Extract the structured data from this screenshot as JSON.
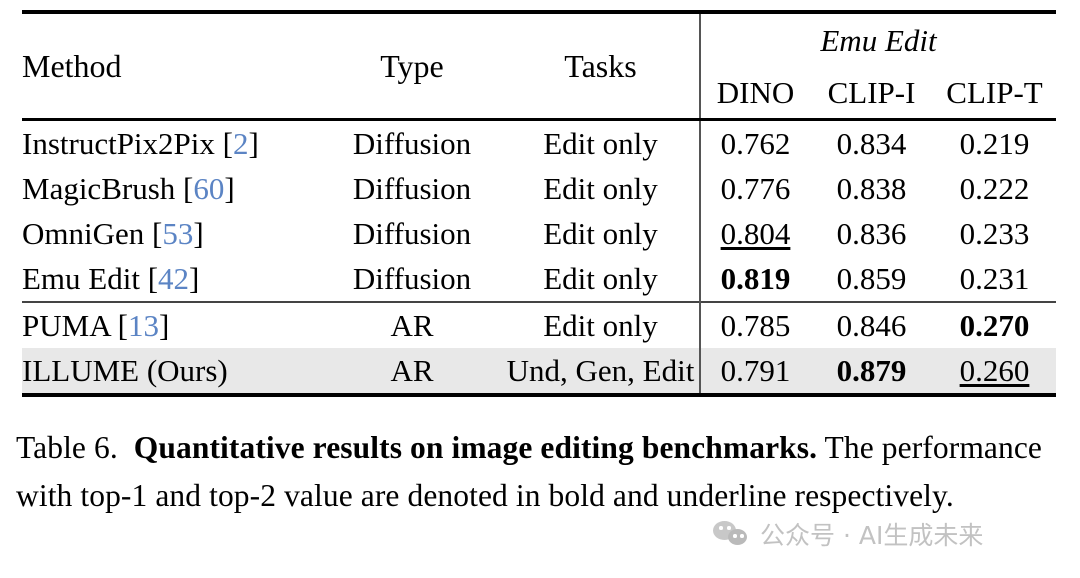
{
  "table": {
    "columns": {
      "method": "Method",
      "type": "Type",
      "tasks": "Tasks",
      "group_label": "Emu Edit",
      "dino": "DINO",
      "clip_i": "CLIP-I",
      "clip_t": "CLIP-T"
    },
    "rows": [
      {
        "method_name": "InstructPix2Pix",
        "citation_open": "[",
        "citation": "2",
        "citation_close": "]",
        "type": "Diffusion",
        "tasks": "Edit only",
        "dino": "0.762",
        "clip_i": "0.834",
        "clip_t": "0.219"
      },
      {
        "method_name": "MagicBrush",
        "citation_open": "[",
        "citation": "60",
        "citation_close": "]",
        "type": "Diffusion",
        "tasks": "Edit only",
        "dino": "0.776",
        "clip_i": "0.838",
        "clip_t": "0.222"
      },
      {
        "method_name": "OmniGen",
        "citation_open": "[",
        "citation": "53",
        "citation_close": "]",
        "type": "Diffusion",
        "tasks": "Edit only",
        "dino": "0.804",
        "clip_i": "0.836",
        "clip_t": "0.233"
      },
      {
        "method_name": "Emu Edit",
        "citation_open": "[",
        "citation": "42",
        "citation_close": "]",
        "type": "Diffusion",
        "tasks": "Edit only",
        "dino": "0.819",
        "clip_i": "0.859",
        "clip_t": "0.231"
      },
      {
        "method_name": "PUMA",
        "citation_open": "[",
        "citation": "13",
        "citation_close": "]",
        "type": "AR",
        "tasks": "Edit only",
        "dino": "0.785",
        "clip_i": "0.846",
        "clip_t": "0.270"
      },
      {
        "method_name": "ILLUME (Ours)",
        "citation_open": "",
        "citation": "",
        "citation_close": "",
        "type": "AR",
        "tasks": "Und, Gen, Edit",
        "dino": "0.791",
        "clip_i": "0.879",
        "clip_t": "0.260"
      }
    ],
    "highlight_color": "#e8e8e8",
    "citation_color": "#5b84c4"
  },
  "caption": {
    "label": "Table 6.",
    "title": "Quantitative results on image editing benchmarks.",
    "body": "The performance with top-1 and top-2 value are denoted in bold and underline respectively."
  },
  "watermark": {
    "text": "公众号 · AI生成未来"
  }
}
